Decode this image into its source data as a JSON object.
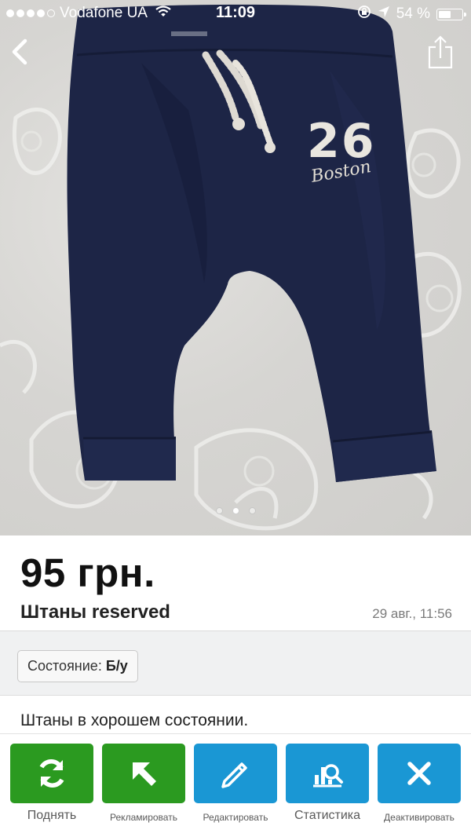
{
  "status_bar": {
    "carrier": "Vodafone UA",
    "time": "11:09",
    "battery_percent": "54 %",
    "battery_level": 0.54,
    "signal_bars": 4
  },
  "gallery": {
    "photo_subject": "navy baby jogger pants",
    "print_number": "26",
    "print_text": "Boston",
    "image_count": 3,
    "active_index": 1
  },
  "listing": {
    "price": "95 грн.",
    "title": "Штаны reserved",
    "date": "29 авг., 11:56"
  },
  "params": {
    "condition_label": "Состояние:",
    "condition_value": "Б/у"
  },
  "description": "Штаны в хорошем состоянии.",
  "actions": [
    {
      "label": "Поднять",
      "icon": "refresh-icon",
      "color": "#2b9a20"
    },
    {
      "label": "Рекламировать",
      "icon": "arrow-up-left-icon",
      "color": "#2b9a20"
    },
    {
      "label": "Редактировать",
      "icon": "pencil-icon",
      "color": "#1a97d4"
    },
    {
      "label": "Статистика",
      "icon": "stats-icon",
      "color": "#1a97d4"
    },
    {
      "label": "Деактивировать",
      "icon": "close-icon",
      "color": "#1a97d4"
    }
  ],
  "colors": {
    "green": "#2b9a20",
    "blue": "#1a97d4",
    "pants": "#1d2546"
  }
}
